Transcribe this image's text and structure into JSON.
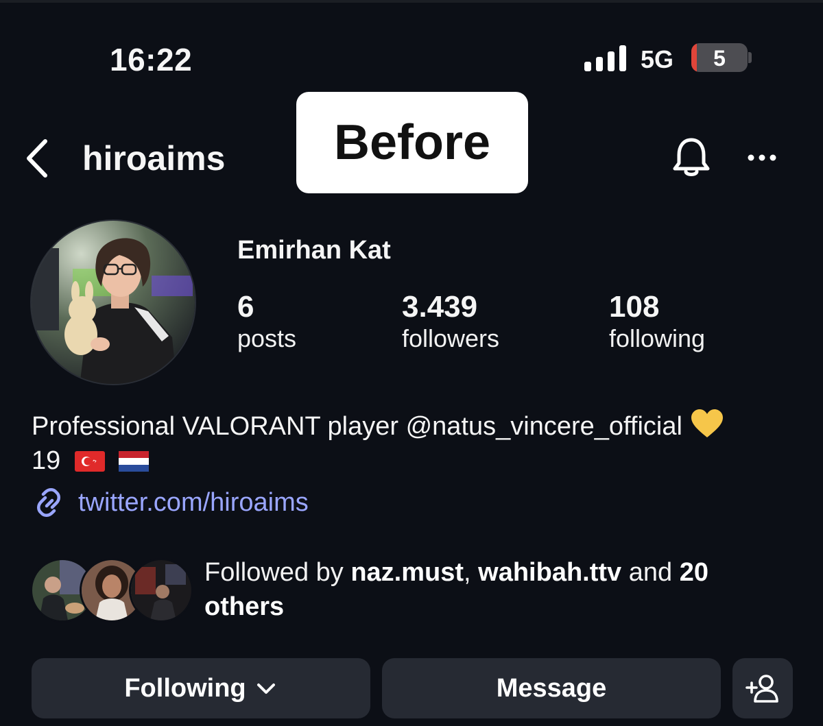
{
  "status_bar": {
    "time": "16:22",
    "network": "5G",
    "battery_level": "5"
  },
  "header": {
    "username": "hiroaims",
    "overlay_label": "Before"
  },
  "profile": {
    "full_name": "Emirhan Kat",
    "stats": [
      {
        "value": "6",
        "label": "posts"
      },
      {
        "value": "3.439",
        "label": "followers"
      },
      {
        "value": "108",
        "label": "following"
      }
    ],
    "bio_line1": "Professional VALORANT player @natus_vincere_official",
    "bio_line2": "19",
    "link": "twitter.com/hiroaims"
  },
  "followed_by": {
    "prefix": "Followed by ",
    "user1": "naz.must",
    "separator": ", ",
    "user2": "wahibah.ttv",
    "middle": " and ",
    "count": "20",
    "suffix": "others"
  },
  "actions": {
    "following_label": "Following",
    "message_label": "Message"
  },
  "colors": {
    "background": "#0c0f16",
    "button": "#262a33",
    "link": "#9aa6ff",
    "battery_low": "#e0453a"
  },
  "icons": [
    "back-chevron-icon",
    "bell-icon",
    "more-icon",
    "link-icon",
    "yellow-heart-icon",
    "turkey-flag-icon",
    "netherlands-flag-icon",
    "chevron-down-icon",
    "add-person-icon"
  ]
}
